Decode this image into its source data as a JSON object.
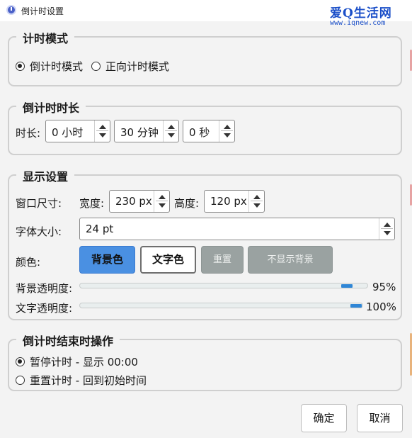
{
  "window": {
    "title": "倒计时设置"
  },
  "watermark": {
    "top": "爱Q生活网",
    "bottom": "www.iqnew.com"
  },
  "timer_mode": {
    "title": "计时模式",
    "options": [
      {
        "label": "倒计时模式",
        "checked": true
      },
      {
        "label": "正向计时模式",
        "checked": false
      }
    ]
  },
  "duration": {
    "title": "倒计时时长",
    "label": "时长:",
    "hours": "0 小时",
    "minutes": "30 分钟",
    "seconds": "0 秒"
  },
  "display": {
    "title": "显示设置",
    "window_size_label": "窗口尺寸:",
    "width_label": "宽度:",
    "width_value": "230 px",
    "height_label": "高度:",
    "height_value": "120 px",
    "font_size_label": "字体大小:",
    "font_size_value": "24 pt",
    "color_label": "颜色:",
    "bg_color_button": "背景色",
    "text_color_button": "文字色",
    "reset_button": "重置",
    "hide_bg_button": "不显示背景",
    "bg_opacity_label": "背景透明度:",
    "bg_opacity_value": "95%",
    "bg_opacity_level": 0.95,
    "text_opacity_label": "文字透明度:",
    "text_opacity_value": "100%",
    "text_opacity_level": 1.0
  },
  "end_action": {
    "title": "倒计时结束时操作",
    "options": [
      {
        "label": "暂停计时 - 显示 00:00",
        "checked": true
      },
      {
        "label": "重置计时 - 回到初始时间",
        "checked": false
      }
    ]
  },
  "footer": {
    "ok_button": "确定",
    "cancel_button": "取消"
  },
  "colors": {
    "accent": "#4a90e2",
    "slider": "#2f86d6",
    "disabled": "#9aa2a1"
  }
}
